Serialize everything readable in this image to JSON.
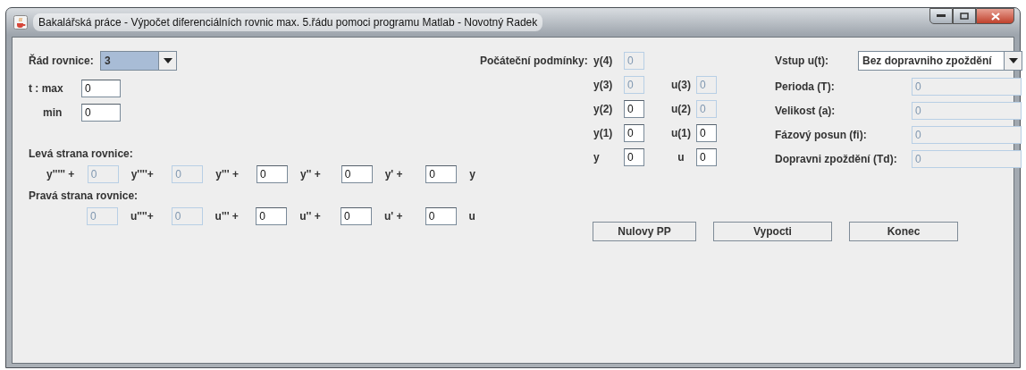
{
  "window": {
    "title": "Bakalářská práce - Výpočet diferenciálních rovnic max. 5.řádu pomoci programu Matlab - Novotný Radek"
  },
  "order": {
    "label": "Řád rovnice:",
    "value": "3",
    "selected": true
  },
  "time": [
    {
      "label": "t : max",
      "value": "0"
    },
    {
      "label": "min",
      "value": "0"
    }
  ],
  "left_side": {
    "label": "Levá strana rovnice:",
    "terms": [
      {
        "prefix": "y''''' +",
        "value": "0",
        "disabled": true
      },
      {
        "prefix": "y''''+",
        "value": "0",
        "disabled": true
      },
      {
        "prefix": "y''' +",
        "value": "0",
        "disabled": false
      },
      {
        "prefix": "y'' +",
        "value": "0",
        "disabled": false
      },
      {
        "prefix": "y' +",
        "value": "0",
        "disabled": false
      }
    ],
    "tail": "y"
  },
  "right_side": {
    "label": "Pravá strana rovnice:",
    "terms": [
      {
        "value": "0",
        "disabled": true
      },
      {
        "prefix": "u''''+",
        "value": "0",
        "disabled": true
      },
      {
        "prefix": "u''' +",
        "value": "0",
        "disabled": false
      },
      {
        "prefix": "u'' +",
        "value": "0",
        "disabled": false
      },
      {
        "prefix": "u' +",
        "value": "0",
        "disabled": false
      }
    ],
    "tail": "u"
  },
  "initial_conditions": {
    "label": "Počáteční podmínky:",
    "rows": [
      {
        "y": {
          "label": "y(4)",
          "value": "0",
          "disabled": true
        }
      },
      {
        "y": {
          "label": "y(3)",
          "value": "0",
          "disabled": true
        },
        "u": {
          "label": "u(3)",
          "value": "0",
          "disabled": true
        }
      },
      {
        "y": {
          "label": "y(2)",
          "value": "0",
          "disabled": false
        },
        "u": {
          "label": "u(2)",
          "value": "0",
          "disabled": true
        }
      },
      {
        "y": {
          "label": "y(1)",
          "value": "0",
          "disabled": false
        },
        "u": {
          "label": "u(1)",
          "value": "0",
          "disabled": false
        }
      },
      {
        "y": {
          "label": "y",
          "value": "0",
          "disabled": false
        },
        "u": {
          "label": "u",
          "value": "0",
          "disabled": false
        }
      }
    ]
  },
  "input_signal": {
    "label": "Vstup u(t):",
    "value": "Bez dopravniho zpoždění"
  },
  "parameters": [
    {
      "label": "Perioda (T):",
      "value": "0",
      "disabled": true
    },
    {
      "label": "Velikost (a):",
      "value": "0",
      "disabled": true
    },
    {
      "label": "Fázový posun (fi):",
      "value": "0",
      "disabled": true
    },
    {
      "label": "Dopravni zpoždění (Td):",
      "value": "0",
      "disabled": true
    }
  ],
  "buttons": [
    "Nulovy PP",
    "Vypocti",
    "Konec"
  ]
}
